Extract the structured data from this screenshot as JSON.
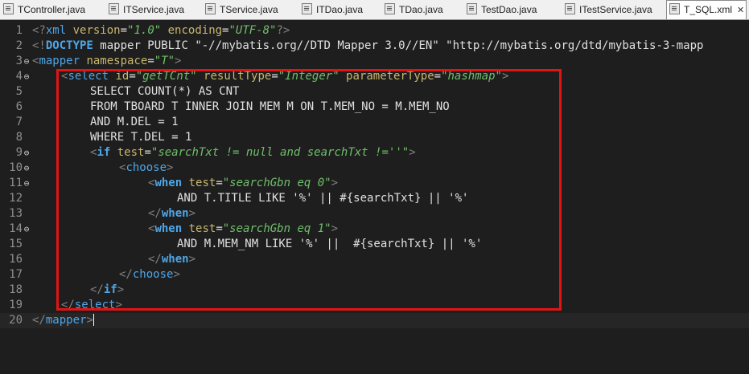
{
  "tabs": [
    {
      "label": "TController.java"
    },
    {
      "label": "ITService.java"
    },
    {
      "label": "TService.java"
    },
    {
      "label": "ITDao.java"
    },
    {
      "label": "TDao.java"
    },
    {
      "label": "TestDao.java"
    },
    {
      "label": "ITestService.java"
    },
    {
      "label": "T_SQL.xml",
      "close": "✕"
    }
  ],
  "line_numbers": [
    "1",
    "2",
    "3",
    "4",
    "5",
    "6",
    "7",
    "8",
    "9",
    "10",
    "11",
    "12",
    "13",
    "14",
    "15",
    "16",
    "17",
    "18",
    "19",
    "20"
  ],
  "code": {
    "l1": {
      "a": "<?",
      "b": "xml",
      "c": " version",
      "d": "=",
      "e": "\"1.0\"",
      "f": " encoding",
      "g": "=",
      "h": "\"UTF-8\"",
      "i": "?>"
    },
    "l2": {
      "a": "<!",
      "b": "DOCTYPE",
      "c": " mapper PUBLIC ",
      "d": "\"-//mybatis.org//DTD Mapper 3.0//EN\"",
      "e": " \"http://mybatis.org/dtd/mybatis-3-mapp"
    },
    "l3": {
      "a": "<",
      "b": "mapper",
      "c": " namespace",
      "d": "=",
      "e": "\"T\"",
      "f": ">"
    },
    "l4": {
      "a": "<",
      "b": "select",
      "c": " id",
      "d": "=",
      "e": "\"getTCnt\"",
      "f": " resultType",
      "g": "=",
      "h": "\"Integer\"",
      "i": " parameterType",
      "j": "=",
      "k": "\"hashmap\"",
      "l": ">"
    },
    "l5": "SELECT COUNT(*) AS CNT",
    "l6": "FROM TBOARD T INNER JOIN MEM M ON T.MEM_NO = M.MEM_NO",
    "l7": "AND M.DEL = 1",
    "l8": "WHERE T.DEL = 1",
    "l9": {
      "a": "<",
      "b": "if",
      "c": " test",
      "d": "=",
      "e": "\"searchTxt != null and searchTxt !=''\"",
      "f": ">"
    },
    "l10": {
      "a": "<",
      "b": "choose",
      "c": ">"
    },
    "l11": {
      "a": "<",
      "b": "when",
      "c": " test",
      "d": "=",
      "e": "\"searchGbn eq 0\"",
      "f": ">"
    },
    "l12": "AND T.TITLE LIKE '%' || #{searchTxt} || '%'",
    "l13": {
      "a": "</",
      "b": "when",
      "c": ">"
    },
    "l14": {
      "a": "<",
      "b": "when",
      "c": " test",
      "d": "=",
      "e": "\"searchGbn eq 1\"",
      "f": ">"
    },
    "l15": "AND M.MEM_NM LIKE '%' ||  #{searchTxt} || '%'",
    "l16": {
      "a": "</",
      "b": "when",
      "c": ">"
    },
    "l17": {
      "a": "</",
      "b": "choose",
      "c": ">"
    },
    "l18": {
      "a": "</",
      "b": "if",
      "c": ">"
    },
    "l19": {
      "a": "</",
      "b": "select",
      "c": ">"
    },
    "l20": {
      "a": "</",
      "b": "mapper",
      "c": ">"
    }
  },
  "fold_marker": "⊖",
  "colors": {
    "background": "#1e1e1e",
    "tag": "#4ea6e8",
    "attribute": "#c9b66e",
    "string": "#6fbf6a",
    "highlight_box": "#e11414"
  }
}
